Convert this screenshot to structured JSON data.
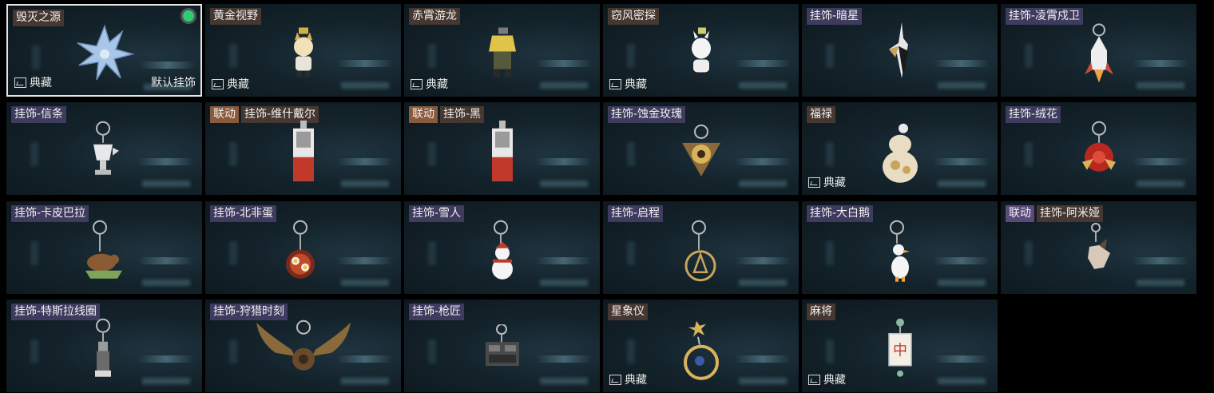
{
  "collection_label": "典藏",
  "default_label": "默认挂饰",
  "linked_label": "联动",
  "items": [
    {
      "name": "毁灭之源",
      "collection": true,
      "default": true,
      "selected": true,
      "charm": "dragon-charm"
    },
    {
      "name": "黄金视野",
      "collection": true,
      "charm": "kitten-charm"
    },
    {
      "name": "赤霄游龙",
      "collection": true,
      "charm": "yellow-figure-charm"
    },
    {
      "name": "窃风密探",
      "collection": true,
      "charm": "white-rabbit-charm"
    },
    {
      "name": "挂饰-暗星",
      "charm": "dark-star-charm"
    },
    {
      "name": "挂饰-凌霄戍卫",
      "charm": "rocket-charm"
    },
    {
      "name": "挂饰-信条",
      "charm": "trophy-charm"
    },
    {
      "name": "挂饰-维什戴尔",
      "linked": "orange",
      "charm": "red-card-charm"
    },
    {
      "name": "挂饰-黑",
      "linked": "orange",
      "charm": "red-card-charm"
    },
    {
      "name": "挂饰-蚀金玫瑰",
      "charm": "gold-emblem-charm"
    },
    {
      "name": "福禄",
      "collection": true,
      "charm": "gourd-charm"
    },
    {
      "name": "挂饰-绒花",
      "charm": "red-rose-charm"
    },
    {
      "name": "挂饰-卡皮巴拉",
      "charm": "capybara-charm"
    },
    {
      "name": "挂饰-北非蛋",
      "charm": "egg-pan-charm"
    },
    {
      "name": "挂饰-雪人",
      "charm": "snowman-charm"
    },
    {
      "name": "挂饰-启程",
      "charm": "compass-charm"
    },
    {
      "name": "挂饰-大白鹅",
      "charm": "goose-charm"
    },
    {
      "name": "挂饰-阿米娅",
      "linked": "purple",
      "charm": "bunny-ear-charm"
    },
    {
      "name": "挂饰-特斯拉线圈",
      "charm": "tesla-coil-charm"
    },
    {
      "name": "挂饰-狩猎时刻",
      "charm": "antler-charm"
    },
    {
      "name": "挂饰-枪匠",
      "charm": "crate-charm"
    },
    {
      "name": "星象仪",
      "collection": true,
      "charm": "astrolabe-charm"
    },
    {
      "name": "麻将",
      "collection": true,
      "charm": "mahjong-charm"
    }
  ],
  "colors": {
    "equipped": "#2ecc71",
    "linked_orange": "#8a5a3c",
    "linked_purple": "#5a4a7a",
    "mahjong_red": "#c0392b"
  }
}
